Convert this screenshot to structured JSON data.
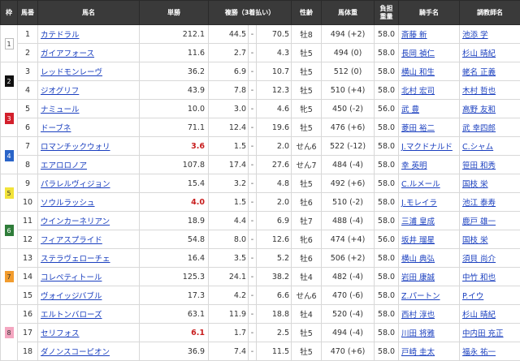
{
  "headers": {
    "frame": "枠",
    "horse_no": "馬番",
    "horse_name": "馬名",
    "win": "単勝",
    "place": "複勝（3着払い）",
    "sex_age": "性齢",
    "weight": "馬体重",
    "burden": "負担重量",
    "jockey": "騎手名",
    "trainer": "調教師名"
  },
  "colors": {
    "frame1": "#ffffff",
    "frame2": "#111111",
    "frame3": "#d3202c",
    "frame4": "#2a64c8",
    "frame5": "#f2e33a",
    "frame6": "#2f7d3a",
    "frame7": "#f29c2e",
    "frame8": "#f4a6c0",
    "link": "#1a3fbf",
    "favorite": "#c81e1e"
  },
  "rows": [
    {
      "frame": "1",
      "frame_color": "#ffffff",
      "frame_text_color": "#333333",
      "no": "1",
      "name": "カテドラル",
      "win": "212.1",
      "fav": false,
      "place_lo": "44.5",
      "dash": "-",
      "place_hi": "70.5",
      "sex_age": "牡8",
      "weight": "494 (+2)",
      "burden": "58.0",
      "jockey": "斎藤 新",
      "trainer": "池添 学"
    },
    {
      "frame": "1",
      "no": "2",
      "name": "ガイアフォース",
      "win": "11.6",
      "fav": false,
      "place_lo": "2.7",
      "dash": "-",
      "place_hi": "4.3",
      "sex_age": "牡5",
      "weight": "494 (0)",
      "burden": "58.0",
      "jockey": "長岡 禎仁",
      "trainer": "杉山 晴紀"
    },
    {
      "frame": "2",
      "frame_color": "#111111",
      "frame_text_color": "#ffffff",
      "no": "3",
      "name": "レッドモンレーヴ",
      "win": "36.2",
      "fav": false,
      "place_lo": "6.9",
      "dash": "-",
      "place_hi": "10.7",
      "sex_age": "牡5",
      "weight": "512 (0)",
      "burden": "58.0",
      "jockey": "横山 和生",
      "trainer": "蛯名 正義"
    },
    {
      "frame": "2",
      "no": "4",
      "name": "ジオグリフ",
      "win": "43.9",
      "fav": false,
      "place_lo": "7.8",
      "dash": "-",
      "place_hi": "12.3",
      "sex_age": "牡5",
      "weight": "510 (+4)",
      "burden": "58.0",
      "jockey": "北村 宏司",
      "trainer": "木村 哲也"
    },
    {
      "frame": "3",
      "frame_color": "#d3202c",
      "frame_text_color": "#ffffff",
      "no": "5",
      "name": "ナミュール",
      "win": "10.0",
      "fav": false,
      "place_lo": "3.0",
      "dash": "-",
      "place_hi": "4.6",
      "sex_age": "牝5",
      "weight": "450 (-2)",
      "burden": "56.0",
      "jockey": "武 豊",
      "trainer": "高野 友和"
    },
    {
      "frame": "3",
      "no": "6",
      "name": "ドーブネ",
      "win": "71.1",
      "fav": false,
      "place_lo": "12.4",
      "dash": "-",
      "place_hi": "19.6",
      "sex_age": "牡5",
      "weight": "476 (+6)",
      "burden": "58.0",
      "jockey": "菱田 裕二",
      "trainer": "武 幸四郎"
    },
    {
      "frame": "4",
      "frame_color": "#2a64c8",
      "frame_text_color": "#ffffff",
      "no": "7",
      "name": "ロマンチックウォリ",
      "win": "3.6",
      "fav": true,
      "place_lo": "1.5",
      "dash": "-",
      "place_hi": "2.0",
      "sex_age": "せん6",
      "weight": "522 (-12)",
      "burden": "58.0",
      "jockey": "J.マクドナルド",
      "trainer": "C.シャム"
    },
    {
      "frame": "4",
      "no": "8",
      "name": "エアロロノア",
      "win": "107.8",
      "fav": false,
      "place_lo": "17.4",
      "dash": "-",
      "place_hi": "27.6",
      "sex_age": "せん7",
      "weight": "484 (-4)",
      "burden": "58.0",
      "jockey": "幸 英明",
      "trainer": "笹田 和秀"
    },
    {
      "frame": "5",
      "frame_color": "#f2e33a",
      "frame_text_color": "#333333",
      "no": "9",
      "name": "パラレルヴィジョン",
      "win": "15.4",
      "fav": false,
      "place_lo": "3.2",
      "dash": "-",
      "place_hi": "4.8",
      "sex_age": "牡5",
      "weight": "492 (+6)",
      "burden": "58.0",
      "jockey": "C.ルメール",
      "trainer": "国枝 栄"
    },
    {
      "frame": "5",
      "no": "10",
      "name": "ソウルラッシュ",
      "win": "4.0",
      "fav": true,
      "place_lo": "1.5",
      "dash": "-",
      "place_hi": "2.0",
      "sex_age": "牡6",
      "weight": "510 (-2)",
      "burden": "58.0",
      "jockey": "J.モレイラ",
      "trainer": "池江 泰寿"
    },
    {
      "frame": "6",
      "frame_color": "#2f7d3a",
      "frame_text_color": "#ffffff",
      "no": "11",
      "name": "ウインカーネリアン",
      "win": "18.9",
      "fav": false,
      "place_lo": "4.4",
      "dash": "-",
      "place_hi": "6.9",
      "sex_age": "牡7",
      "weight": "488 (-4)",
      "burden": "58.0",
      "jockey": "三浦 皇成",
      "trainer": "鹿戸 雄一"
    },
    {
      "frame": "6",
      "no": "12",
      "name": "フィアスプライド",
      "win": "54.8",
      "fav": false,
      "place_lo": "8.0",
      "dash": "-",
      "place_hi": "12.6",
      "sex_age": "牝6",
      "weight": "474 (+4)",
      "burden": "56.0",
      "jockey": "坂井 瑠星",
      "trainer": "国枝 栄"
    },
    {
      "frame": "7",
      "frame_color": "#f29c2e",
      "frame_text_color": "#333333",
      "no": "13",
      "name": "ステラヴェローチェ",
      "win": "16.4",
      "fav": false,
      "place_lo": "3.5",
      "dash": "-",
      "place_hi": "5.2",
      "sex_age": "牡6",
      "weight": "506 (+2)",
      "burden": "58.0",
      "jockey": "横山 典弘",
      "trainer": "須貝 尚介"
    },
    {
      "frame": "7",
      "no": "14",
      "name": "コレペティトール",
      "win": "125.3",
      "fav": false,
      "place_lo": "24.1",
      "dash": "-",
      "place_hi": "38.2",
      "sex_age": "牡4",
      "weight": "482 (-4)",
      "burden": "58.0",
      "jockey": "岩田 康誠",
      "trainer": "中竹 和也"
    },
    {
      "frame": "7",
      "no": "15",
      "name": "ヴォイッジバブル",
      "win": "17.3",
      "fav": false,
      "place_lo": "4.2",
      "dash": "-",
      "place_hi": "6.6",
      "sex_age": "せん6",
      "weight": "470 (-6)",
      "burden": "58.0",
      "jockey": "Z.パートン",
      "trainer": "P.イウ"
    },
    {
      "frame": "8",
      "frame_color": "#f4a6c0",
      "frame_text_color": "#333333",
      "no": "16",
      "name": "エルトンバローズ",
      "win": "63.1",
      "fav": false,
      "place_lo": "11.9",
      "dash": "-",
      "place_hi": "18.8",
      "sex_age": "牡4",
      "weight": "520 (-4)",
      "burden": "58.0",
      "jockey": "西村 淳也",
      "trainer": "杉山 晴紀"
    },
    {
      "frame": "8",
      "no": "17",
      "name": "セリフォス",
      "win": "6.1",
      "fav": true,
      "place_lo": "1.7",
      "dash": "-",
      "place_hi": "2.5",
      "sex_age": "牡5",
      "weight": "494 (-4)",
      "burden": "58.0",
      "jockey": "川田 将雅",
      "trainer": "中内田 充正"
    },
    {
      "frame": "8",
      "no": "18",
      "name": "ダノンスコーピオン",
      "win": "36.9",
      "fav": false,
      "place_lo": "7.4",
      "dash": "-",
      "place_hi": "11.5",
      "sex_age": "牡5",
      "weight": "470 (+6)",
      "burden": "58.0",
      "jockey": "戸崎 圭太",
      "trainer": "福永 祐一"
    }
  ]
}
